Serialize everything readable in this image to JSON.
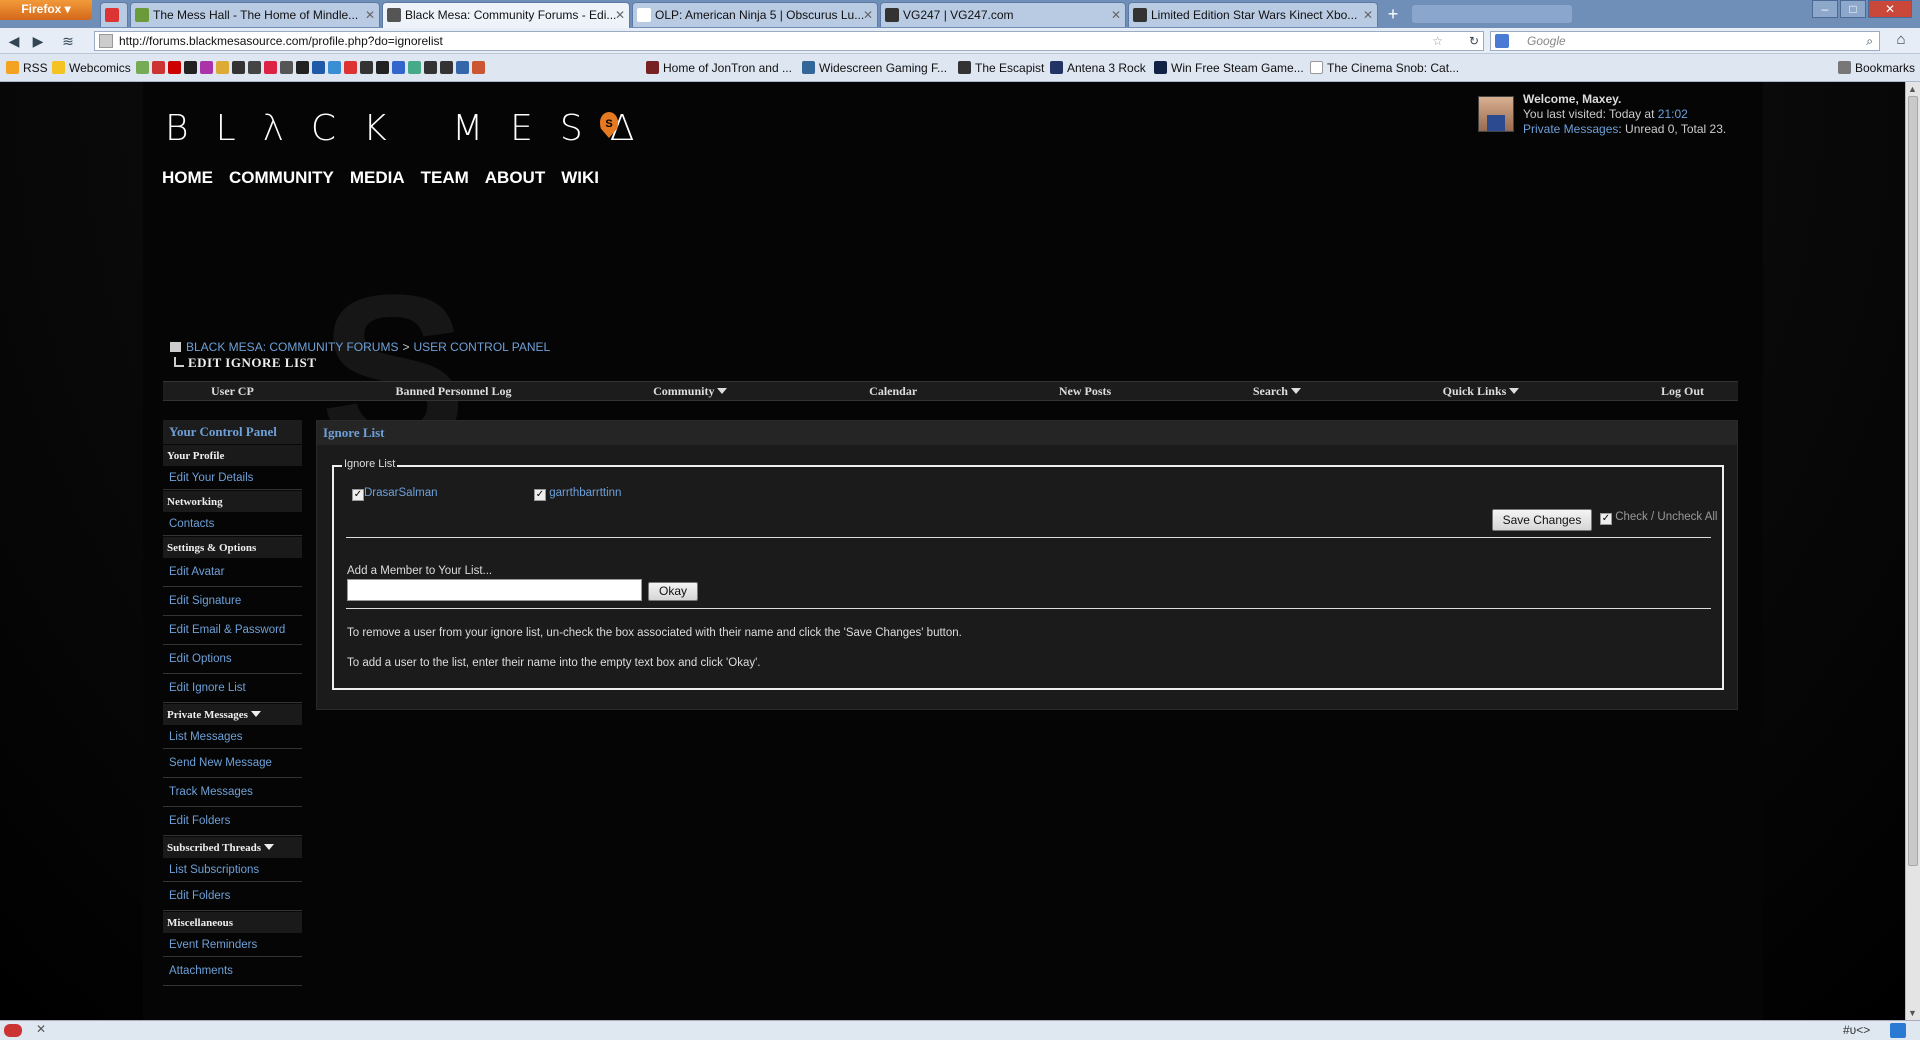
{
  "browser": {
    "menu_button": "Firefox",
    "tabs": [
      {
        "title": "",
        "icon": "gmail-icon"
      },
      {
        "title": "The Mess Hall - The Home of Mindle...",
        "icon": "page-icon"
      },
      {
        "title": "Black Mesa: Community Forums - Edi...",
        "icon": "page-icon",
        "active": true
      },
      {
        "title": "OLP: American Ninja 5 | Obscurus Lu...",
        "icon": "page-icon"
      },
      {
        "title": "VG247 | VG247.com",
        "icon": "page-icon"
      },
      {
        "title": "Limited Edition Star Wars Kinect Xbo...",
        "icon": "page-icon"
      }
    ],
    "url": "http://forums.blackmesasource.com/profile.php?do=ignorelist",
    "search_placeholder": "Google",
    "bookmarks": {
      "rss": "RSS",
      "webcomics": "Webcomics",
      "jontron": "Home of JonTron and ...",
      "widescreen": "Widescreen Gaming F...",
      "escapist": "The Escapist",
      "antena": "Antena 3 Rock",
      "steam": "Win Free Steam Game...",
      "cinema": "The Cinema Snob: Cat...",
      "bookmarks_menu": "Bookmarks"
    },
    "status_right": "#υ<>"
  },
  "site": {
    "logo": "BLλCK MESΔ",
    "logo_badge": "S",
    "nav": [
      "HOME",
      "COMMUNITY",
      "MEDIA",
      "TEAM",
      "ABOUT",
      "WIKI"
    ],
    "welcome_prefix": "Welcome, ",
    "username": "Maxey.",
    "last_visited_prefix": "You last visited: Today at ",
    "last_visited_time": "21:02",
    "pm_link": "Private Messages",
    "pm_counts": ": Unread 0, Total 23."
  },
  "breadcrumb": {
    "forums": "BLACK MESA: COMMUNITY FORUMS",
    "separator": ">",
    "ucp": "USER CONTROL PANEL",
    "current": "EDIT IGNORE LIST"
  },
  "navstrip": {
    "user_cp": "User CP",
    "banned": "Banned Personnel Log",
    "community": "Community",
    "calendar": "Calendar",
    "new_posts": "New Posts",
    "search": "Search",
    "quick_links": "Quick Links",
    "log_out": "Log Out"
  },
  "sidebar": {
    "header": "Your Control Panel",
    "your_profile": "Your Profile",
    "edit_details": "Edit Your Details",
    "networking": "Networking",
    "contacts": "Contacts",
    "settings": "Settings & Options",
    "edit_avatar": "Edit Avatar",
    "edit_signature": "Edit Signature",
    "edit_email": "Edit Email & Password",
    "edit_options": "Edit Options",
    "edit_ignore": "Edit Ignore List",
    "private_messages": "Private Messages",
    "list_messages": "List Messages",
    "send_message": "Send New Message",
    "track_messages": "Track Messages",
    "edit_folders": "Edit Folders",
    "subscribed_threads": "Subscribed Threads",
    "list_subscriptions": "List Subscriptions",
    "edit_folders_2": "Edit Folders",
    "miscellaneous": "Miscellaneous",
    "event_reminders": "Event Reminders",
    "attachments": "Attachments"
  },
  "panel": {
    "title": "Ignore List",
    "legend": "Ignore List",
    "ignored_users": [
      "DrasarSalman",
      "garrthbarrttinn"
    ],
    "save_button": "Save Changes",
    "check_all": "Check / Uncheck All",
    "add_label": "Add a Member to Your List...",
    "add_value": "",
    "okay_button": "Okay",
    "help_remove": "To remove a user from your ignore list, un-check the box associated with their name and click the 'Save Changes' button.",
    "help_add": "To add a user to the list, enter their name into the empty text box and click 'Okay'."
  }
}
